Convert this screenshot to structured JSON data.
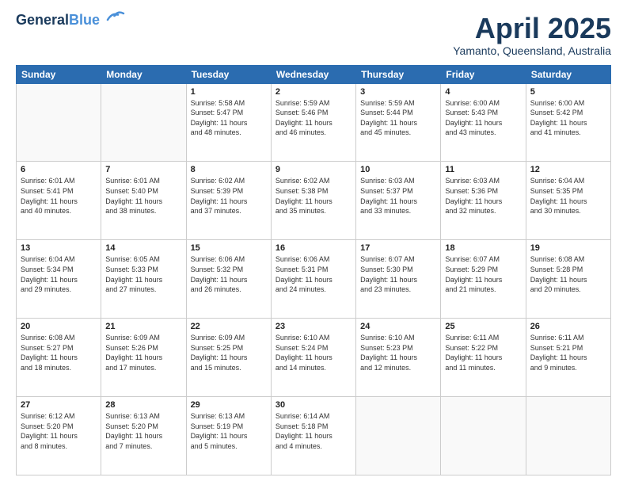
{
  "header": {
    "logo_line1": "General",
    "logo_line2": "Blue",
    "month": "April 2025",
    "location": "Yamanto, Queensland, Australia"
  },
  "weekdays": [
    "Sunday",
    "Monday",
    "Tuesday",
    "Wednesday",
    "Thursday",
    "Friday",
    "Saturday"
  ],
  "weeks": [
    [
      {
        "day": "",
        "info": ""
      },
      {
        "day": "",
        "info": ""
      },
      {
        "day": "1",
        "info": "Sunrise: 5:58 AM\nSunset: 5:47 PM\nDaylight: 11 hours\nand 48 minutes."
      },
      {
        "day": "2",
        "info": "Sunrise: 5:59 AM\nSunset: 5:46 PM\nDaylight: 11 hours\nand 46 minutes."
      },
      {
        "day": "3",
        "info": "Sunrise: 5:59 AM\nSunset: 5:44 PM\nDaylight: 11 hours\nand 45 minutes."
      },
      {
        "day": "4",
        "info": "Sunrise: 6:00 AM\nSunset: 5:43 PM\nDaylight: 11 hours\nand 43 minutes."
      },
      {
        "day": "5",
        "info": "Sunrise: 6:00 AM\nSunset: 5:42 PM\nDaylight: 11 hours\nand 41 minutes."
      }
    ],
    [
      {
        "day": "6",
        "info": "Sunrise: 6:01 AM\nSunset: 5:41 PM\nDaylight: 11 hours\nand 40 minutes."
      },
      {
        "day": "7",
        "info": "Sunrise: 6:01 AM\nSunset: 5:40 PM\nDaylight: 11 hours\nand 38 minutes."
      },
      {
        "day": "8",
        "info": "Sunrise: 6:02 AM\nSunset: 5:39 PM\nDaylight: 11 hours\nand 37 minutes."
      },
      {
        "day": "9",
        "info": "Sunrise: 6:02 AM\nSunset: 5:38 PM\nDaylight: 11 hours\nand 35 minutes."
      },
      {
        "day": "10",
        "info": "Sunrise: 6:03 AM\nSunset: 5:37 PM\nDaylight: 11 hours\nand 33 minutes."
      },
      {
        "day": "11",
        "info": "Sunrise: 6:03 AM\nSunset: 5:36 PM\nDaylight: 11 hours\nand 32 minutes."
      },
      {
        "day": "12",
        "info": "Sunrise: 6:04 AM\nSunset: 5:35 PM\nDaylight: 11 hours\nand 30 minutes."
      }
    ],
    [
      {
        "day": "13",
        "info": "Sunrise: 6:04 AM\nSunset: 5:34 PM\nDaylight: 11 hours\nand 29 minutes."
      },
      {
        "day": "14",
        "info": "Sunrise: 6:05 AM\nSunset: 5:33 PM\nDaylight: 11 hours\nand 27 minutes."
      },
      {
        "day": "15",
        "info": "Sunrise: 6:06 AM\nSunset: 5:32 PM\nDaylight: 11 hours\nand 26 minutes."
      },
      {
        "day": "16",
        "info": "Sunrise: 6:06 AM\nSunset: 5:31 PM\nDaylight: 11 hours\nand 24 minutes."
      },
      {
        "day": "17",
        "info": "Sunrise: 6:07 AM\nSunset: 5:30 PM\nDaylight: 11 hours\nand 23 minutes."
      },
      {
        "day": "18",
        "info": "Sunrise: 6:07 AM\nSunset: 5:29 PM\nDaylight: 11 hours\nand 21 minutes."
      },
      {
        "day": "19",
        "info": "Sunrise: 6:08 AM\nSunset: 5:28 PM\nDaylight: 11 hours\nand 20 minutes."
      }
    ],
    [
      {
        "day": "20",
        "info": "Sunrise: 6:08 AM\nSunset: 5:27 PM\nDaylight: 11 hours\nand 18 minutes."
      },
      {
        "day": "21",
        "info": "Sunrise: 6:09 AM\nSunset: 5:26 PM\nDaylight: 11 hours\nand 17 minutes."
      },
      {
        "day": "22",
        "info": "Sunrise: 6:09 AM\nSunset: 5:25 PM\nDaylight: 11 hours\nand 15 minutes."
      },
      {
        "day": "23",
        "info": "Sunrise: 6:10 AM\nSunset: 5:24 PM\nDaylight: 11 hours\nand 14 minutes."
      },
      {
        "day": "24",
        "info": "Sunrise: 6:10 AM\nSunset: 5:23 PM\nDaylight: 11 hours\nand 12 minutes."
      },
      {
        "day": "25",
        "info": "Sunrise: 6:11 AM\nSunset: 5:22 PM\nDaylight: 11 hours\nand 11 minutes."
      },
      {
        "day": "26",
        "info": "Sunrise: 6:11 AM\nSunset: 5:21 PM\nDaylight: 11 hours\nand 9 minutes."
      }
    ],
    [
      {
        "day": "27",
        "info": "Sunrise: 6:12 AM\nSunset: 5:20 PM\nDaylight: 11 hours\nand 8 minutes."
      },
      {
        "day": "28",
        "info": "Sunrise: 6:13 AM\nSunset: 5:20 PM\nDaylight: 11 hours\nand 7 minutes."
      },
      {
        "day": "29",
        "info": "Sunrise: 6:13 AM\nSunset: 5:19 PM\nDaylight: 11 hours\nand 5 minutes."
      },
      {
        "day": "30",
        "info": "Sunrise: 6:14 AM\nSunset: 5:18 PM\nDaylight: 11 hours\nand 4 minutes."
      },
      {
        "day": "",
        "info": ""
      },
      {
        "day": "",
        "info": ""
      },
      {
        "day": "",
        "info": ""
      }
    ]
  ]
}
